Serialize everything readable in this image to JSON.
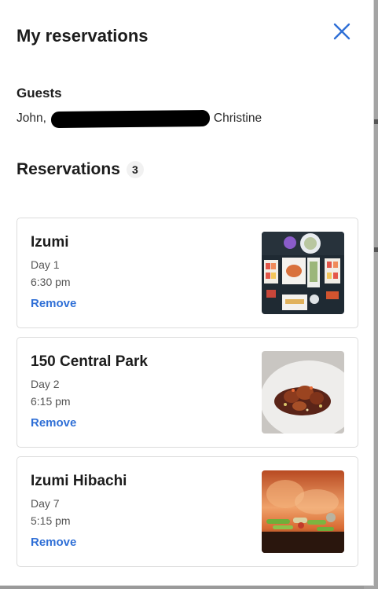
{
  "modal": {
    "title": "My reservations",
    "close_icon": "close-icon"
  },
  "guests": {
    "heading": "Guests",
    "first": "John,",
    "last": "Christine"
  },
  "reservations": {
    "heading": "Reservations",
    "count": "3",
    "items": [
      {
        "name": "Izumi",
        "day": "Day 1",
        "time": "6:30 pm",
        "remove_label": "Remove",
        "image": "sushi-platter-photo"
      },
      {
        "name": "150 Central Park",
        "day": "Day 2",
        "time": "6:15 pm",
        "remove_label": "Remove",
        "image": "plated-dish-photo"
      },
      {
        "name": "Izumi Hibachi",
        "day": "Day 7",
        "time": "5:15 pm",
        "remove_label": "Remove",
        "image": "hibachi-grill-photo"
      }
    ]
  },
  "colors": {
    "accent": "#2f6fd6",
    "text": "#1c1c1c",
    "muted": "#555555"
  }
}
